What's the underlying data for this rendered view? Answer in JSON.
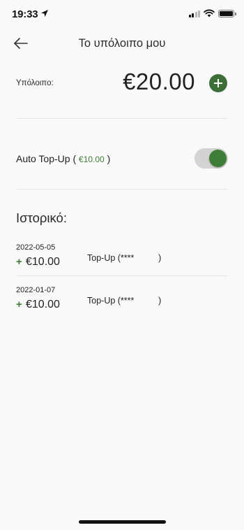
{
  "status_bar": {
    "time": "19:33"
  },
  "nav": {
    "title": "Το υπόλοιπο μου"
  },
  "balance": {
    "label": "Υπόλοιπο:",
    "value": "€20.00"
  },
  "auto_topup": {
    "label": "Auto Top-Up",
    "open_paren": "(",
    "amount": "€10.00",
    "close_paren": ")",
    "enabled": true
  },
  "history": {
    "title": "Ιστορικό:",
    "items": [
      {
        "date": "2022-05-05",
        "sign": "+",
        "amount": "€10.00",
        "description": "Top-Up (****          )"
      },
      {
        "date": "2022-01-07",
        "sign": "+",
        "amount": "€10.00",
        "description": "Top-Up (****          )"
      }
    ]
  },
  "colors": {
    "accent_green": "#3e7d35",
    "button_green": "#3e6e38",
    "background": "#f9f9f9"
  },
  "icons": {
    "back": "arrow-left-icon",
    "add": "plus-icon",
    "location": "location-arrow-icon"
  }
}
